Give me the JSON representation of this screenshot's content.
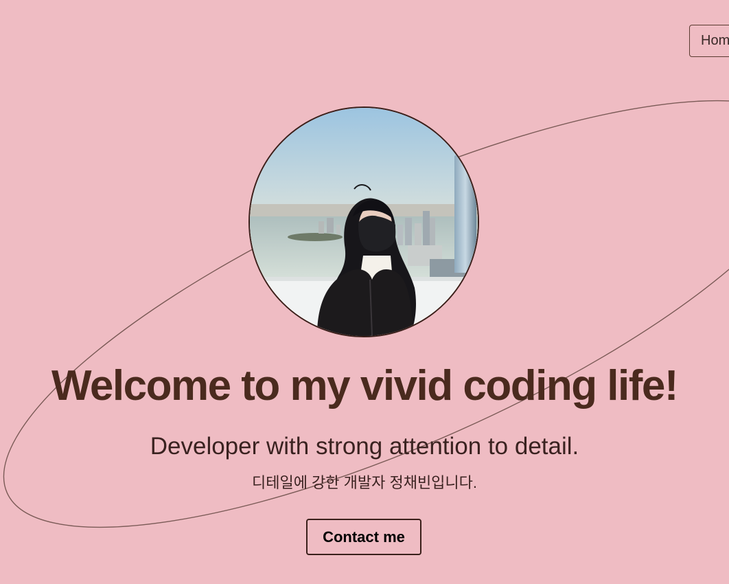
{
  "nav": {
    "home_label": "Home"
  },
  "hero": {
    "headline": "Welcome to my vivid coding life!",
    "tagline": "Developer with strong attention to detail.",
    "tagline_ko": "디테일에 강한 개발자 정채빈입니다.",
    "contact_label": "Contact me"
  },
  "colors": {
    "background": "#efbcc3",
    "headline": "#4a2a1e",
    "border": "#3a1f1a"
  }
}
